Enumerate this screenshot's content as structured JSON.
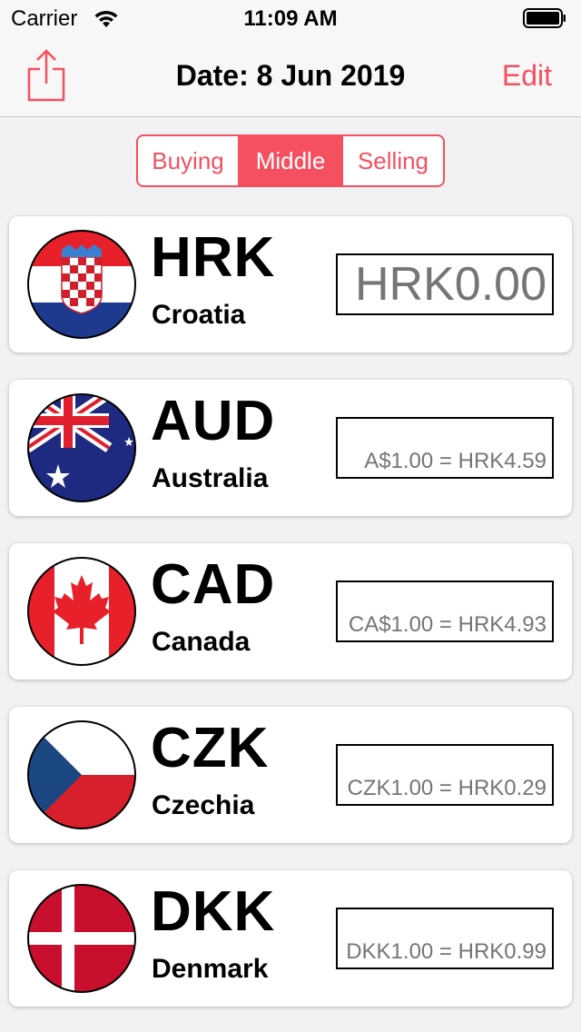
{
  "status_bar": {
    "carrier": "Carrier",
    "time": "11:09 AM"
  },
  "nav": {
    "title": "Date: 8 Jun 2019",
    "edit_label": "Edit",
    "share_icon": "share-icon"
  },
  "segments": {
    "items": [
      "Buying",
      "Middle",
      "Selling"
    ],
    "selected": "Middle"
  },
  "currencies": [
    {
      "code": "HRK",
      "country": "Croatia",
      "placeholder": "HRK0.00",
      "flag_icon": "croatia-flag-icon"
    },
    {
      "code": "AUD",
      "country": "Australia",
      "placeholder": "A$1.00 = HRK4.59",
      "flag_icon": "australia-flag-icon"
    },
    {
      "code": "CAD",
      "country": "Canada",
      "placeholder": "CA$1.00 = HRK4.93",
      "flag_icon": "canada-flag-icon"
    },
    {
      "code": "CZK",
      "country": "Czechia",
      "placeholder": "CZK1.00 = HRK0.29",
      "flag_icon": "czechia-flag-icon"
    },
    {
      "code": "DKK",
      "country": "Denmark",
      "placeholder": "DKK1.00 = HRK0.99",
      "flag_icon": "denmark-flag-icon"
    }
  ],
  "colors": {
    "accent": "#f4505f",
    "placeholder": "#c7c7cc"
  }
}
